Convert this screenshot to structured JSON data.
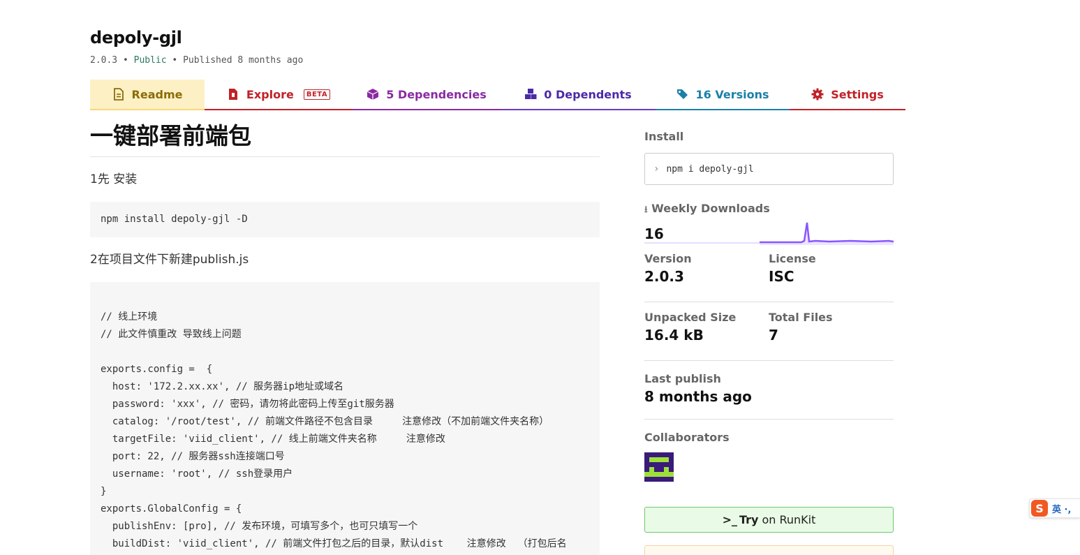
{
  "package": {
    "name": "depoly-gjl",
    "version": "2.0.3",
    "sep": " • ",
    "visibility": "Public",
    "published": "Published 8 months ago"
  },
  "tabs": {
    "readme": "Readme",
    "explore": "Explore",
    "explore_badge": "BETA",
    "dependencies": "5 Dependencies",
    "dependents": "0 Dependents",
    "versions": "16 Versions",
    "settings": "Settings"
  },
  "readme": {
    "title": "一键部署前端包",
    "step1": "1先 安装",
    "install_code": "npm install depoly-gjl -D",
    "step2": "2在项目文件下新建publish.js",
    "config_code": "// 线上环境\n// 此文件慎重改 导致线上问题\n\nexports.config =  {\n  host: '172.2.xx.xx', // 服务器ip地址或域名\n  password: 'xxx', // 密码，请勿将此密码上传至git服务器\n  catalog: '/root/test', // 前端文件路径不包含目录     注意修改（不加前端文件夹名称）\n  targetFile: 'viid_client', // 线上前端文件夹名称     注意修改\n  port: 22, // 服务器ssh连接端口号\n  username: 'root', // ssh登录用户\n}\nexports.GlobalConfig = {\n  publishEnv: [pro], // 发布环境，可填写多个，也可只填写一个\n  buildDist: 'viid_client', // 前端文件打包之后的目录，默认dist    注意修改  （打包后名"
  },
  "sidebar": {
    "install_label": "Install",
    "install_command": "npm i depoly-gjl",
    "weekly_downloads_label": "Weekly Downloads",
    "weekly_downloads_value": "16",
    "version_label": "Version",
    "version_value": "2.0.3",
    "license_label": "License",
    "license_value": "ISC",
    "unpacked_size_label": "Unpacked Size",
    "unpacked_size_value": "16.4 kB",
    "total_files_label": "Total Files",
    "total_files_value": "7",
    "last_publish_label": "Last publish",
    "last_publish_value": "8 months ago",
    "collaborators_label": "Collaborators",
    "runkit_try": "Try",
    "runkit_rest": "on RunKit"
  },
  "ime": {
    "label": "英 ·,"
  },
  "colors": {
    "readme_tab": "#8a6d0b",
    "explore_tab": "#c12127",
    "dependencies_tab": "#8a2aa2",
    "dependents_tab": "#4b2aa8",
    "versions_tab": "#1b7fa8",
    "settings_tab": "#c12127",
    "sparkline": "#8956ff"
  }
}
